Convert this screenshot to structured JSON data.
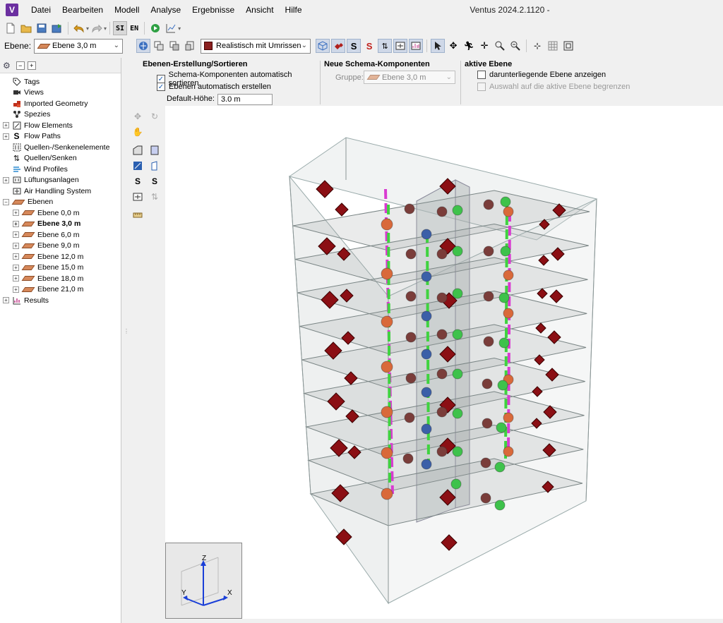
{
  "app": {
    "logo": "V",
    "window_title": "Ventus 2024.2.1120 -",
    "menu": [
      "Datei",
      "Bearbeiten",
      "Modell",
      "Analyse",
      "Ergebnisse",
      "Ansicht",
      "Hilfe"
    ]
  },
  "toolbar": {
    "si_label": "SI",
    "en_label": "EN"
  },
  "level_bar": {
    "label": "Ebene:",
    "selected_level": "Ebene 3,0 m",
    "view_mode": "Realistisch mit Umrissen"
  },
  "tree": {
    "items": [
      {
        "label": "Tags",
        "icon": "tag-icon",
        "expandable": false
      },
      {
        "label": "Views",
        "icon": "camera-icon",
        "expandable": false
      },
      {
        "label": "Imported Geometry",
        "icon": "geometry-icon",
        "expandable": false
      },
      {
        "label": "Spezies",
        "icon": "molecule-icon",
        "expandable": false
      },
      {
        "label": "Flow Elements",
        "icon": "flow-element-icon",
        "expandable": true
      },
      {
        "label": "Flow Paths",
        "icon": "flow-path-icon",
        "expandable": true
      },
      {
        "label": "Quellen-/Senkenelemente",
        "icon": "source-sink-element-icon",
        "expandable": false
      },
      {
        "label": "Quellen/Senken",
        "icon": "source-sink-icon",
        "expandable": false
      },
      {
        "label": "Wind Profiles",
        "icon": "wind-icon",
        "expandable": false
      },
      {
        "label": "Lüftungsanlagen",
        "icon": "ventilation-icon",
        "expandable": true
      },
      {
        "label": "Air Handling System",
        "icon": "ahs-icon",
        "expandable": false
      }
    ],
    "levels_label": "Ebenen",
    "levels": [
      "Ebene 0,0 m",
      "Ebene 3,0 m",
      "Ebene 6,0 m",
      "Ebene 9,0 m",
      "Ebene 12,0 m",
      "Ebene 15,0 m",
      "Ebene 18,0 m",
      "Ebene 21,0 m"
    ],
    "active_level": "Ebene 3,0 m",
    "results_label": "Results"
  },
  "ribbon": {
    "level_creation": {
      "title": "Ebenen-Erstellung/Sortieren",
      "auto_sort_label": "Schema-Komponenten automatisch sortieren",
      "auto_sort_checked": true,
      "auto_create_label": "Ebenen automatisch erstellen",
      "auto_create_checked": true,
      "default_height_label": "Default-Höhe:",
      "default_height_value": "3.0 m"
    },
    "new_components": {
      "title": "Neue Schema-Komponenten",
      "group_label": "Gruppe:",
      "group_value": "Ebene 3,0 m"
    },
    "active_level": {
      "title": "aktive Ebene",
      "show_below_label": "darunterliegende Ebene anzeigen",
      "show_below_checked": false,
      "restrict_label": "Auswahl auf die aktive Ebene begrenzen",
      "restrict_checked": false
    }
  },
  "axes": {
    "z": "Z",
    "x": "X",
    "y": "Y"
  },
  "colors": {
    "accent_purple": "#6b2fa0",
    "diamond_red": "#8b0f14",
    "sphere_orange": "#d9693a",
    "sphere_green": "#3ec24b",
    "sphere_blue": "#3b5fa8",
    "pipe_magenta": "#d93bd1",
    "pipe_green": "#3fd33f"
  }
}
